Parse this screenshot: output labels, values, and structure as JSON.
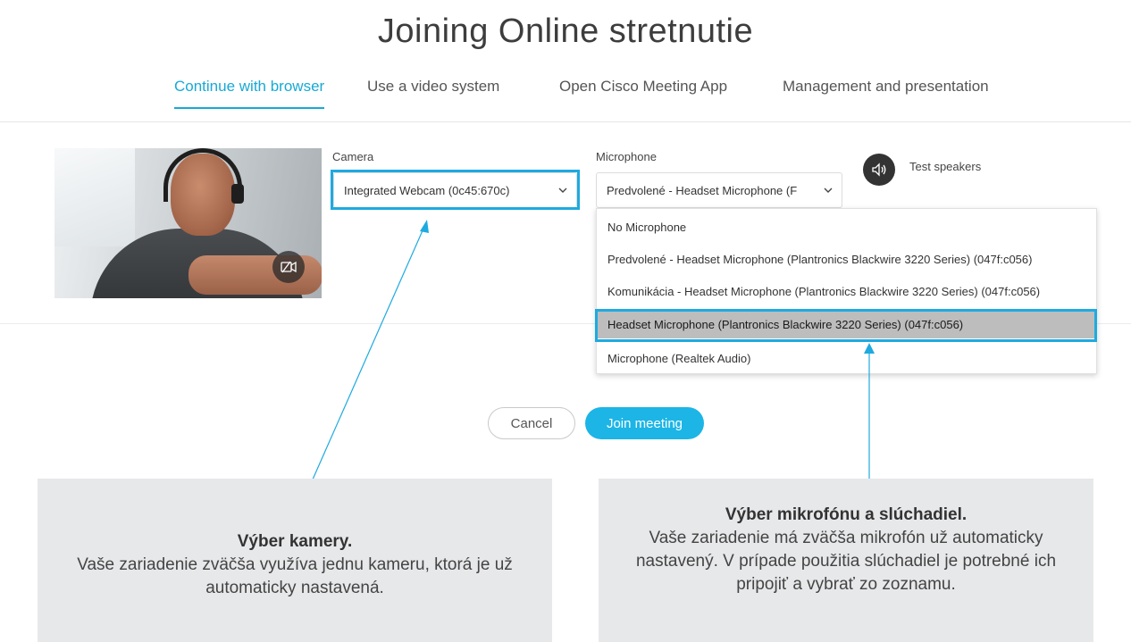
{
  "header": {
    "title": "Joining Online stretnutie"
  },
  "tabs": [
    {
      "label": "Continue with browser",
      "active": true
    },
    {
      "label": "Use a video system",
      "active": false
    },
    {
      "label": "Open Cisco Meeting App",
      "active": false
    },
    {
      "label": "Management and presentation",
      "active": false
    }
  ],
  "camera": {
    "label": "Camera",
    "selected": "Integrated Webcam (0c45:670c)"
  },
  "microphone": {
    "label": "Microphone",
    "selected": "Predvolené - Headset Microphone (F",
    "options": [
      "No Microphone",
      "Predvolené - Headset Microphone (Plantronics Blackwire 3220 Series) (047f:c056)",
      "Komunikácia - Headset Microphone (Plantronics Blackwire 3220 Series) (047f:c056)",
      "Headset Microphone (Plantronics Blackwire 3220 Series) (047f:c056)",
      "Microphone (Realtek Audio)"
    ],
    "highlighted_index": 3
  },
  "speakers": {
    "label": "Test speakers"
  },
  "actions": {
    "cancel": "Cancel",
    "join": "Join meeting"
  },
  "notes": {
    "camera": {
      "heading": "Výber kamery.",
      "body": "Vaše zariadenie zväčša využíva jednu kameru, ktorá je už automaticky nastavená."
    },
    "microphone": {
      "heading": "Výber mikrofónu a slúchadiel.",
      "body": "Vaše zariadenie má zväčša mikrofón už automaticky nastavený. V prípade použitia slúchadiel je potrebné ich pripojiť a vybrať zo zoznamu."
    }
  },
  "icons": {
    "camera_toggle": "camera-off-icon",
    "speaker": "speaker-icon",
    "chevron": "chevron-down-icon"
  },
  "colors": {
    "accent": "#17a9d5",
    "join_button": "#1cb5e6",
    "highlight_box": "#1eaae0",
    "note_background": "#e7e8ea"
  }
}
